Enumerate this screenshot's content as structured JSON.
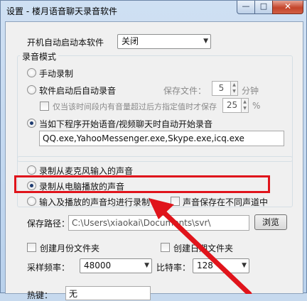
{
  "window": {
    "title": "设置 - 楼月语音聊天录音软件",
    "controls": {
      "minimize": "—",
      "maximize": "□",
      "close": "✕"
    }
  },
  "autostart": {
    "label": "开机自动启动本软件",
    "value": "关闭"
  },
  "record_mode": {
    "group_label": "录音模式",
    "manual": "手动录制",
    "auto_after_start": "软件启动后自动录音",
    "save_file_label": "保存文件：",
    "save_minutes": "5",
    "minutes_unit": "分钟",
    "only_save_label": "仅当该时间段内有音量超过后方指定值时才保存",
    "volume_threshold": "25",
    "percent_unit": "%",
    "program_voice": "当如下程序开始语音/视频聊天时自动开始录音",
    "programs": "QQ.exe,YahooMessenger.exe,Skype.exe,icq.exe"
  },
  "source": {
    "mic": "录制从麦克风输入的声音",
    "pc": "录制从电脑播放的声音",
    "both": "输入及播放的声音均进行录制",
    "separate_channels": "声音保存在不同声道中"
  },
  "save_path": {
    "label": "保存路径：",
    "value": "C:\\Users\\xiaokai\\Documents\\svr\\",
    "browse": "浏览"
  },
  "folders": {
    "month": "创建月份文件夹",
    "date": "创建日期文件夹"
  },
  "audio": {
    "sample_rate_label": "采样频率：",
    "sample_rate": "48000",
    "bitrate_label": "比特率：",
    "bitrate": "128"
  },
  "hotkey": {
    "label": "热键：",
    "value": "无"
  },
  "colors": {
    "highlight": "#e0141b",
    "arrow": "#e0141b"
  }
}
